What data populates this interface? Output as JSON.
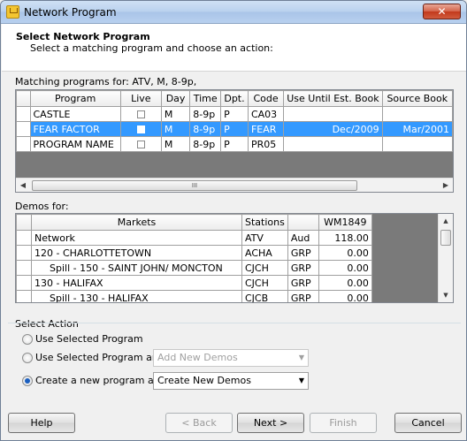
{
  "window": {
    "title": "Network Program",
    "close_glyph": "✕"
  },
  "header": {
    "title": "Select Network Program",
    "subtitle": "Select a matching program and choose an action:"
  },
  "programs": {
    "label": "Matching programs for: ATV, M, 8-9p,",
    "columns": [
      "Program",
      "Live",
      "Day",
      "Time",
      "Dpt.",
      "Code",
      "Use Until Est. Book",
      "Source Book"
    ],
    "rows": [
      {
        "program": "CASTLE",
        "live": false,
        "day": "M",
        "time": "8-9p",
        "dpt": "P",
        "code": "CA03",
        "use_until": "",
        "source_book": "",
        "selected": false
      },
      {
        "program": "FEAR FACTOR",
        "live": true,
        "day": "M",
        "time": "8-9p",
        "dpt": "P",
        "code": "FEAR",
        "use_until": "Dec/2009",
        "source_book": "Mar/2001",
        "selected": true
      },
      {
        "program": "PROGRAM NAME",
        "live": false,
        "day": "M",
        "time": "8-9p",
        "dpt": "P",
        "code": "PR05",
        "use_until": "",
        "source_book": "",
        "selected": false
      }
    ],
    "scroll_left": "◀",
    "scroll_right": "▶",
    "thumb_grip": "III"
  },
  "demos": {
    "label": "Demos for:",
    "columns": [
      "Markets",
      "Stations",
      "",
      "WM1849"
    ],
    "rows": [
      {
        "market": "Network",
        "station": "ATV",
        "type": "Aud",
        "value": "118.00",
        "indent": false
      },
      {
        "market": "120 - CHARLOTTETOWN",
        "station": "ACHA",
        "type": "GRP",
        "value": "0.00",
        "indent": false
      },
      {
        "market": "Spill - 150 - SAINT JOHN/ MONCTON",
        "station": "CJCH",
        "type": "GRP",
        "value": "0.00",
        "indent": true
      },
      {
        "market": "130 - HALIFAX",
        "station": "CJCH",
        "type": "GRP",
        "value": "0.00",
        "indent": false
      },
      {
        "market": "Spill - 130 - HALIFAX",
        "station": "CJCB",
        "type": "GRP",
        "value": "0.00",
        "indent": true
      }
    ],
    "scroll_up": "▲",
    "scroll_down": "▼"
  },
  "action": {
    "label": "Select Action",
    "options": [
      {
        "label": "Use Selected Program",
        "checked": false
      },
      {
        "label": "Use Selected Program and",
        "checked": false,
        "combo": "Add New Demos",
        "combo_enabled": false
      },
      {
        "label": "Create a new program and",
        "checked": true,
        "combo": "Create New Demos",
        "combo_enabled": true
      }
    ],
    "combo_arrow": "▼"
  },
  "buttons": {
    "help": "Help",
    "back": "< Back",
    "next": "Next >",
    "finish": "Finish",
    "cancel": "Cancel"
  }
}
